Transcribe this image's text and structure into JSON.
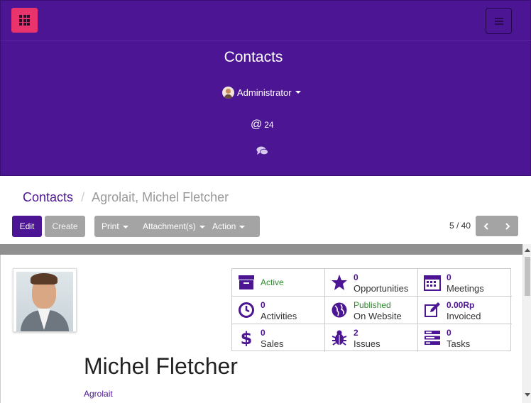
{
  "colors": {
    "brand": "#4c1593",
    "apps_button": "#e8336d",
    "muted_button": "#a4a4a4",
    "success": "#2e8b2e"
  },
  "header": {
    "title": "Contacts",
    "user_name": "Administrator",
    "mentions_count": "24",
    "apps_icon": "grid-icon",
    "menu_icon": "hamburger-icon",
    "chat_icon": "comments-icon"
  },
  "breadcrumb": {
    "parent": "Contacts",
    "separator": "/",
    "current": "Agrolait, Michel Fletcher"
  },
  "toolbar": {
    "edit_label": "Edit",
    "create_label": "Create",
    "print_label": "Print",
    "attachments_label": "Attachment(s)",
    "action_label": "Action"
  },
  "pager": {
    "value": "5 / 40"
  },
  "stats": [
    {
      "icon": "archive-icon",
      "label": "Active"
    },
    {
      "icon": "star-icon",
      "value": "0",
      "label": "Opportunities"
    },
    {
      "icon": "calendar-icon",
      "value": "0",
      "label": "Meetings"
    },
    {
      "icon": "clock-icon",
      "value": "0",
      "label": "Activities"
    },
    {
      "icon": "globe-icon",
      "value": "Published",
      "label": "On Website"
    },
    {
      "icon": "edit-icon",
      "value": "0.00Rp",
      "label": "Invoiced"
    },
    {
      "icon": "dollar-icon",
      "value": "0",
      "label": "Sales"
    },
    {
      "icon": "bug-icon",
      "value": "2",
      "label": "Issues"
    },
    {
      "icon": "tasks-icon",
      "value": "0",
      "label": "Tasks"
    }
  ],
  "partner": {
    "name": "Michel Fletcher",
    "company": "Agrolait"
  }
}
